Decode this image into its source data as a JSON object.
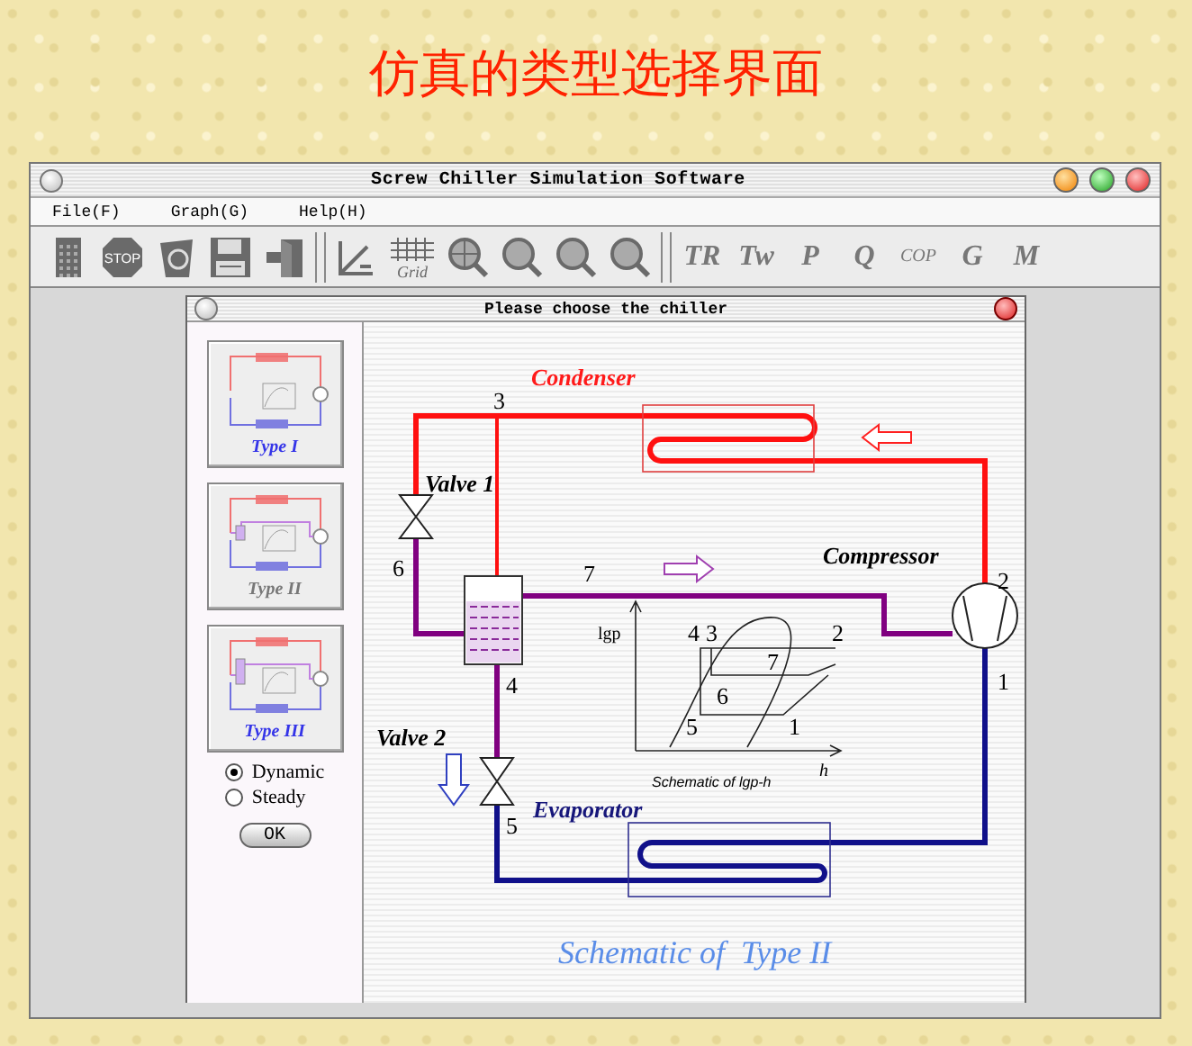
{
  "heading": "仿真的类型选择界面",
  "window": {
    "title": "Screw Chiller Simulation Software"
  },
  "menu": [
    "File(F)",
    "Graph(G)",
    "Help(H)"
  ],
  "toolbar": [
    [
      {
        "kind": "calculator"
      },
      {
        "kind": "stop",
        "label": "STOP"
      },
      {
        "kind": "recycle"
      },
      {
        "kind": "save"
      },
      {
        "kind": "exit"
      }
    ],
    [
      {
        "kind": "measure"
      },
      {
        "kind": "grid",
        "label": "Grid"
      },
      {
        "kind": "locator"
      },
      {
        "kind": "magnifier"
      },
      {
        "kind": "magnifier"
      },
      {
        "kind": "magnifier"
      }
    ],
    [
      {
        "kind": "text",
        "label": "TR"
      },
      {
        "kind": "text",
        "label": "Tw"
      },
      {
        "kind": "text",
        "label": "P"
      },
      {
        "kind": "text",
        "label": "Q"
      },
      {
        "kind": "small",
        "label": "COP"
      },
      {
        "kind": "text",
        "label": "G"
      },
      {
        "kind": "text",
        "label": "M"
      }
    ]
  ],
  "dialog": {
    "title": "Please choose the chiller",
    "types": [
      {
        "label": "Type I",
        "selected": false
      },
      {
        "label": "Type II",
        "selected": true
      },
      {
        "label": "Type III",
        "selected": false
      }
    ],
    "modes": [
      {
        "label": "Dynamic",
        "selected": true
      },
      {
        "label": "Steady",
        "selected": false
      }
    ],
    "ok": "OK",
    "schematic": {
      "condenser": "Condenser",
      "compressor": "Compressor",
      "evaporator": "Evaporator",
      "valve_1": "Valve 1",
      "valve_2": "Valve 2",
      "state_points": [
        "1",
        "2",
        "3",
        "4",
        "5",
        "6",
        "7"
      ],
      "chart": {
        "y_axis": "lgp",
        "x_axis": "h",
        "points": [
          "4",
          "3",
          "2",
          "7",
          "6",
          "5",
          "1"
        ],
        "caption": "Schematic of lgp-h"
      },
      "caption": "Schematic of  Type II"
    }
  }
}
